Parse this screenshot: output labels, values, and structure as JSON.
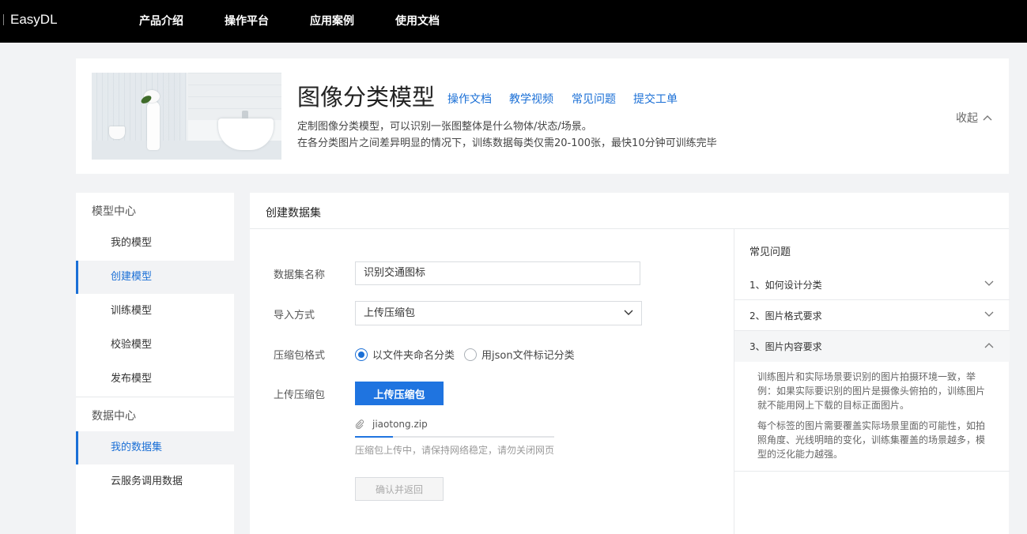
{
  "brand": {
    "name": "EasyDL"
  },
  "nav": [
    "产品介绍",
    "操作平台",
    "应用案例",
    "使用文档"
  ],
  "hero": {
    "title": "图像分类模型",
    "links": [
      "操作文档",
      "教学视频",
      "常见问题",
      "提交工单"
    ],
    "desc_line1": "定制图像分类模型，可以识别一张图整体是什么物体/状态/场景。",
    "desc_line2": "在各分类图片之间差异明显的情况下，训练数据每类仅需20-100张，最快10分钟可训练完毕",
    "collapse_label": "收起"
  },
  "sidebar": {
    "group1": "模型中心",
    "group1_items": [
      "我的模型",
      "创建模型",
      "训练模型",
      "校验模型",
      "发布模型"
    ],
    "group2": "数据中心",
    "group2_items": [
      "我的数据集",
      "云服务调用数据"
    ]
  },
  "main": {
    "title": "创建数据集",
    "form": {
      "name_label": "数据集名称",
      "name_value": "识别交通图标",
      "import_label": "导入方式",
      "import_value": "上传压缩包",
      "format_label": "压缩包格式",
      "format_option1": "以文件夹命名分类",
      "format_option2": "用json文件标记分类",
      "format_selected": "以文件夹命名分类",
      "upload_label": "上传压缩包",
      "upload_button": "上传压缩包",
      "file_name": "jiaotong.zip",
      "upload_progress": 0.19,
      "upload_hint": "压缩包上传中，请保持网络稳定，请勿关闭网页",
      "confirm_button": "确认并返回"
    }
  },
  "faq": {
    "title": "常见问题",
    "items": [
      "1、如何设计分类",
      "2、图片格式要求",
      "3、图片内容要求"
    ],
    "answer_p1": "训练图片和实际场景要识别的图片拍摄环境一致，举例：如果实际要识别的图片是摄像头俯拍的，训练图片就不能用网上下载的目标正面图片。",
    "answer_p2": "每个标签的图片需要覆盖实际场景里面的可能性，如拍照角度、光线明暗的变化，训练集覆盖的场景越多，模型的泛化能力越强。"
  },
  "colors": {
    "accent": "#1a6fd6",
    "topbar": "#000000",
    "background": "#f2f3f5"
  }
}
